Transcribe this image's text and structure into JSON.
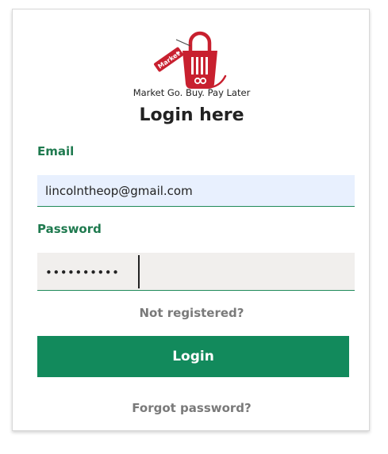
{
  "brand": {
    "logo_text": "Market",
    "tagline": "Market Go. Buy. Pay Later",
    "primary_color": "#128a5c",
    "logo_color": "#c8202f"
  },
  "form": {
    "title": "Login here",
    "email_label": "Email",
    "email_value": "lincolntheop@gmail.com",
    "password_label": "Password",
    "password_masked": "••••••••••",
    "not_registered_link": "Not registered?",
    "login_button": "Login",
    "forgot_password_link": "Forgot password?"
  }
}
